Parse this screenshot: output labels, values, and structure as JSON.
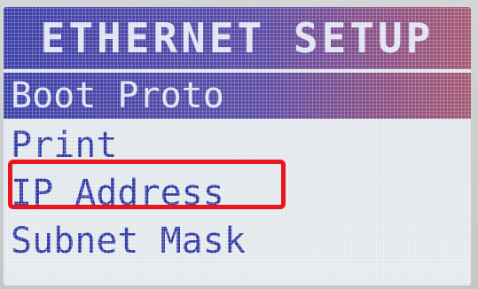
{
  "header": {
    "title": "ETHERNET SETUP"
  },
  "menu": {
    "items": [
      {
        "label": "Boot Proto",
        "selected": true
      },
      {
        "label": "Print",
        "selected": false
      },
      {
        "label": "IP Address",
        "selected": false
      },
      {
        "label": "Subnet Mask",
        "selected": false
      }
    ]
  },
  "annotation": {
    "highlighted_item": "IP Address",
    "color": "#e8171d"
  },
  "colors": {
    "title_bar_start": "#3b3fa7",
    "title_bar_end": "#a45873",
    "text": "#2f39a4",
    "background": "#e1e6ea"
  }
}
